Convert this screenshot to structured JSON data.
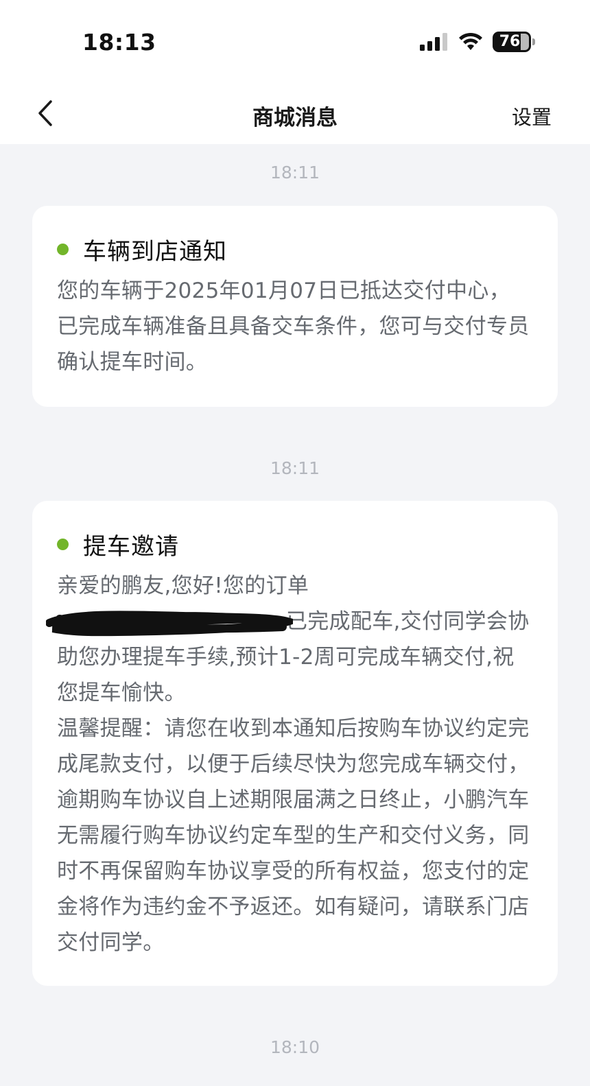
{
  "status_bar": {
    "time": "18:13",
    "battery": "76",
    "icons": [
      "cellular-signal-icon",
      "wifi-icon",
      "battery-icon"
    ]
  },
  "nav": {
    "back_icon": "chevron-left-icon",
    "title": "商城消息",
    "settings_label": "设置"
  },
  "messages": [
    {
      "timestamp": "18:11",
      "title": "车辆到店通知",
      "body": "您的车辆于2025年01月07日已抵达交付中心，已完成车辆准备且具备交车条件，您可与交付专员确认提车时间。"
    },
    {
      "timestamp": "18:11",
      "title": "提车邀请",
      "body_line1": "亲爱的鹏友,您好!您的订单",
      "body_after_redaction": "已完成配车,交付同学会协助您办理提车手续,预计1-2周可完成车辆交付,祝您提车愉快。",
      "body_reminder": "温馨提醒：请您在收到本通知后按购车协议约定完成尾款支付，以便于后续尽快为您完成车辆交付，逾期购车协议自上述期限届满之日终止，小鹏汽车无需履行购车协议约定车型的生产和交付义务，同时不再保留购车协议享受的所有权益，您支付的定金将作为违约金不予返还。如有疑问，请联系门店交付同学。"
    },
    {
      "timestamp": "18:10"
    }
  ],
  "colors": {
    "background": "#f3f4f7",
    "card": "#ffffff",
    "dot_green": "#72b52a",
    "timestamp_gray": "#b3b6bd",
    "body_gray": "#666a70"
  }
}
